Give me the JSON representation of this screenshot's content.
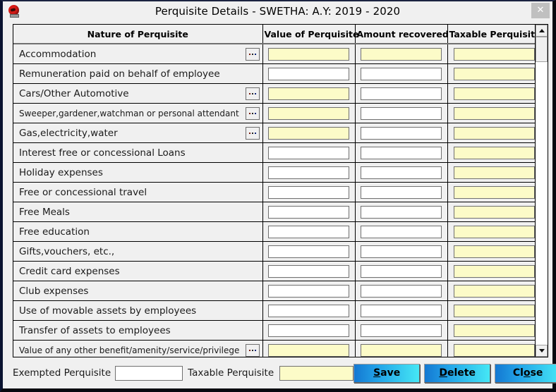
{
  "window": {
    "title": "Perquisite Details - SWETHA: A.Y: 2019 - 2020",
    "close_label": "✕",
    "icon": "app-icon"
  },
  "grid": {
    "headers": [
      "Nature of Perquisite",
      "Value of Perquisite",
      "Amount recovered",
      "Taxable Perquisite"
    ],
    "rows": [
      {
        "name": "Accommodation",
        "has_dots": true,
        "small": false,
        "value": "",
        "value_yellow": true,
        "amount": "",
        "amount_yellow": true,
        "taxable": "",
        "taxable_yellow": true
      },
      {
        "name": "Remuneration paid on behalf of employee",
        "has_dots": false,
        "small": false,
        "value": "",
        "value_yellow": false,
        "amount": "",
        "amount_yellow": false,
        "taxable": "",
        "taxable_yellow": true
      },
      {
        "name": "Cars/Other Automotive",
        "has_dots": true,
        "small": false,
        "value": "",
        "value_yellow": true,
        "amount": "",
        "amount_yellow": false,
        "taxable": "",
        "taxable_yellow": true
      },
      {
        "name": "Sweeper,gardener,watchman or personal attendant",
        "has_dots": true,
        "small": true,
        "value": "",
        "value_yellow": true,
        "amount": "",
        "amount_yellow": false,
        "taxable": "",
        "taxable_yellow": true
      },
      {
        "name": "Gas,electricity,water",
        "has_dots": true,
        "small": false,
        "value": "",
        "value_yellow": true,
        "amount": "",
        "amount_yellow": false,
        "taxable": "",
        "taxable_yellow": true
      },
      {
        "name": "Interest free or concessional Loans",
        "has_dots": false,
        "small": false,
        "value": "",
        "value_yellow": false,
        "amount": "",
        "amount_yellow": false,
        "taxable": "",
        "taxable_yellow": true
      },
      {
        "name": "Holiday expenses",
        "has_dots": false,
        "small": false,
        "value": "",
        "value_yellow": false,
        "amount": "",
        "amount_yellow": false,
        "taxable": "",
        "taxable_yellow": true
      },
      {
        "name": "Free or concessional travel",
        "has_dots": false,
        "small": false,
        "value": "",
        "value_yellow": false,
        "amount": "",
        "amount_yellow": false,
        "taxable": "",
        "taxable_yellow": true
      },
      {
        "name": "Free Meals",
        "has_dots": false,
        "small": false,
        "value": "",
        "value_yellow": false,
        "amount": "",
        "amount_yellow": false,
        "taxable": "",
        "taxable_yellow": true
      },
      {
        "name": "Free education",
        "has_dots": false,
        "small": false,
        "value": "",
        "value_yellow": false,
        "amount": "",
        "amount_yellow": false,
        "taxable": "",
        "taxable_yellow": true
      },
      {
        "name": "Gifts,vouchers, etc.,",
        "has_dots": false,
        "small": false,
        "value": "",
        "value_yellow": false,
        "amount": "",
        "amount_yellow": false,
        "taxable": "",
        "taxable_yellow": true
      },
      {
        "name": "Credit card expenses",
        "has_dots": false,
        "small": false,
        "value": "",
        "value_yellow": false,
        "amount": "",
        "amount_yellow": false,
        "taxable": "",
        "taxable_yellow": true
      },
      {
        "name": "Club expenses",
        "has_dots": false,
        "small": false,
        "value": "",
        "value_yellow": false,
        "amount": "",
        "amount_yellow": false,
        "taxable": "",
        "taxable_yellow": true
      },
      {
        "name": "Use of movable assets by employees",
        "has_dots": false,
        "small": false,
        "value": "",
        "value_yellow": false,
        "amount": "",
        "amount_yellow": false,
        "taxable": "",
        "taxable_yellow": true
      },
      {
        "name": "Transfer of assets to employees",
        "has_dots": false,
        "small": false,
        "value": "",
        "value_yellow": false,
        "amount": "",
        "amount_yellow": false,
        "taxable": "",
        "taxable_yellow": true
      },
      {
        "name": "Value of any other benefit/amenity/service/privilege",
        "has_dots": true,
        "small": true,
        "value": "",
        "value_yellow": true,
        "amount": "",
        "amount_yellow": true,
        "taxable": "",
        "taxable_yellow": true
      }
    ]
  },
  "scrollbar": {
    "up_icon": "scroll-up-arrow-icon",
    "down_icon": "scroll-down-arrow-icon"
  },
  "footer": {
    "exempted_label": "Exempted Perquisite",
    "exempted_value": "",
    "taxable_label": "Taxable Perquisite",
    "taxable_value": "",
    "buttons": [
      {
        "name": "save",
        "pre": "",
        "accel": "S",
        "post": "ave"
      },
      {
        "name": "delete",
        "pre": "",
        "accel": "D",
        "post": "elete"
      },
      {
        "name": "close",
        "pre": "Cl",
        "accel": "o",
        "post": "se"
      }
    ]
  },
  "colors": {
    "button_gradient_start": "#1478d2",
    "button_gradient_end": "#45e7f5",
    "field_highlight": "#fcfbc8",
    "window_background": "#f0f0f0"
  }
}
